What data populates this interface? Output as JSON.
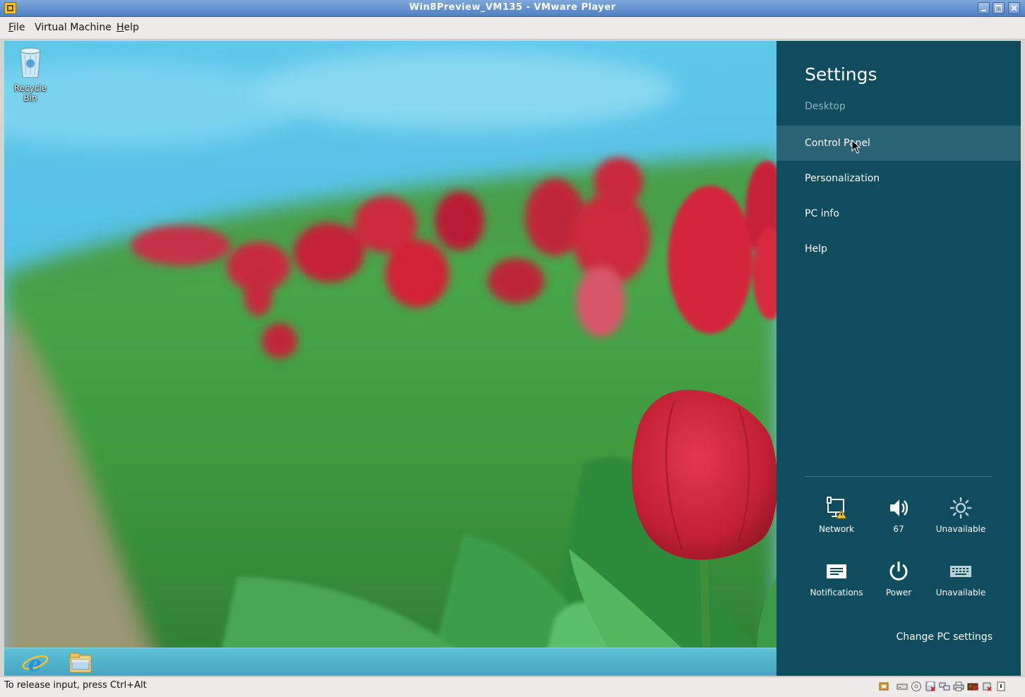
{
  "window": {
    "title": "Win8Preview_VM135 - VMware Player"
  },
  "menu": {
    "items": [
      {
        "key": "F",
        "rest": "ile"
      },
      {
        "key": "",
        "pre": "",
        "label": "Virtual Machine"
      },
      {
        "key": "H",
        "rest": "elp"
      }
    ],
    "file_key": "F",
    "file_rest": "ile",
    "vm_label": "Virtual Machine",
    "help_key": "H",
    "help_rest": "elp"
  },
  "desktop": {
    "recycle_bin_label": "Recycle Bin",
    "taskbar_icons": [
      "internet-explorer-icon",
      "file-explorer-icon"
    ]
  },
  "charm": {
    "title": "Settings",
    "context": "Desktop",
    "items": [
      "Control Panel",
      "Personalization",
      "PC info",
      "Help"
    ],
    "hovered_item": "Control Panel",
    "tiles": [
      {
        "icon": "network-warning-icon",
        "label": "Network"
      },
      {
        "icon": "volume-icon",
        "label": "67"
      },
      {
        "icon": "brightness-icon",
        "label": "Unavailable"
      },
      {
        "icon": "notifications-icon",
        "label": "Notifications"
      },
      {
        "icon": "power-icon",
        "label": "Power"
      },
      {
        "icon": "keyboard-icon",
        "label": "Unavailable"
      }
    ],
    "change_settings": "Change PC settings",
    "colors": {
      "pane": "#0f4d5e",
      "hover": "#2a6373",
      "subtle_text": "#8fb4be"
    }
  },
  "statusbar": {
    "message": "To release input, press Ctrl+Alt",
    "device_icons": [
      "usb-icon",
      "hard-disk-icon",
      "cd-icon",
      "floppy-icon",
      "network-adapter-icon",
      "printer-icon",
      "sound-icon",
      "removable-device-icon",
      "message-icon"
    ]
  }
}
